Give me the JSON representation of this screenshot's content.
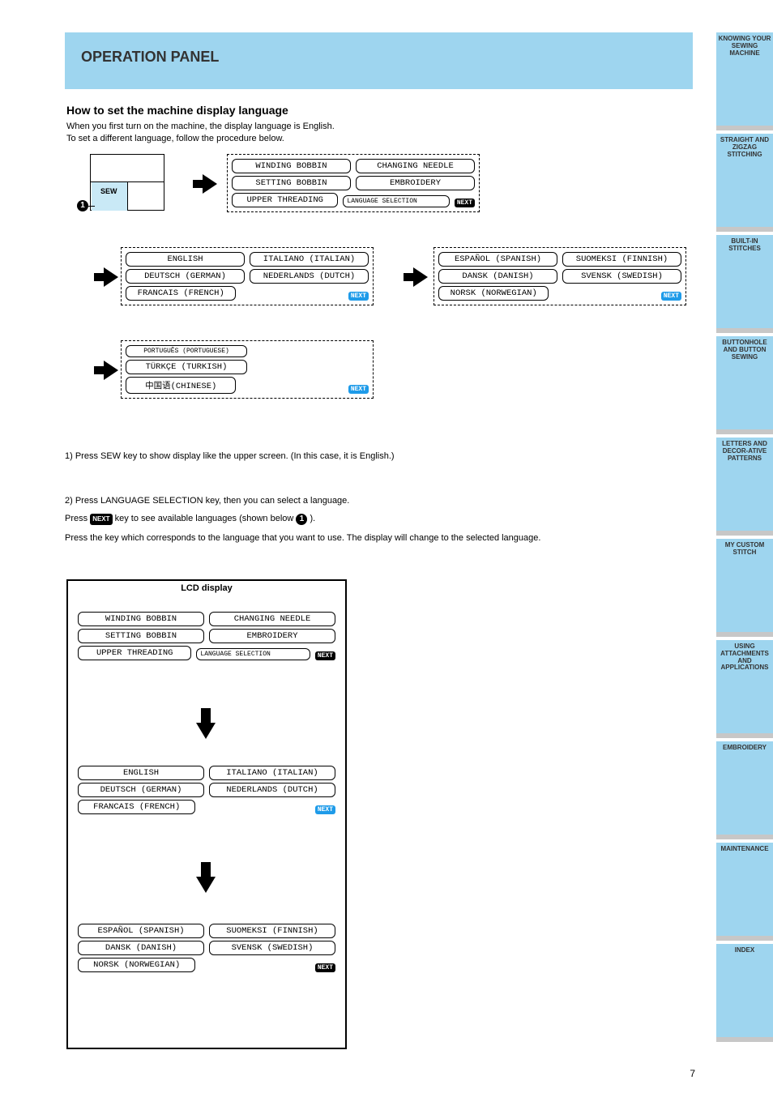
{
  "header": {
    "title": "OPERATION PANEL",
    "subtitle": "How to set the machine display language",
    "text1": "When you first turn on the machine, the display language is English.",
    "text2": "To set a different language, follow the procedure below."
  },
  "sew_btn": "SEW",
  "circle1": "1",
  "arrows": {
    "dummy": ""
  },
  "panelA": {
    "r1c1": "WINDING BOBBIN",
    "r1c2": "CHANGING NEEDLE",
    "r2c1": "SETTING BOBBIN",
    "r2c2": "EMBROIDERY",
    "r3c1": "UPPER THREADING",
    "r3c2": "LANGUAGE SELECTION",
    "next": "NEXT"
  },
  "panelB": {
    "r1c1": "ENGLISH",
    "r1c2": "ITALIANO (ITALIAN)",
    "r2c1": "DEUTSCH (GERMAN)",
    "r2c2": "NEDERLANDS (DUTCH)",
    "r3c1": "FRANCAIS (FRENCH)",
    "next": "NEXT"
  },
  "panelC": {
    "r1c1": "ESPAÑOL (SPANISH)",
    "r1c2": "SUOMEKSI (FINNISH)",
    "r2c1": "DANSK (DANISH)",
    "r2c2": "SVENSK (SWEDISH)",
    "r3c1": "NORSK (NORWEGIAN)",
    "next": "NEXT"
  },
  "panelD": {
    "r1c1": "PORTUGUÊS (PORTUGUESE)",
    "r2c1": "TÜRKÇE (TURKISH)",
    "r3c1": "中国语(CHINESE)",
    "next": "NEXT"
  },
  "para1": "1) Press   SEW   key to show display like the upper screen. (In this case, it is English.)",
  "para2a": "2) Press   LANGUAGE SELECTION   key, then you can select a language.",
  "para2b_prefix": "    Press ",
  "para2b_suffix": " key to see available languages (shown below ",
  "para2b_ref": "1",
  "para2b_end": ").",
  "para2c": "    Press the key which corresponds to the language that you want to use. The display will change to the selected language.",
  "lcd_title": "LCD display",
  "page": "7",
  "tabs": [
    "KNOWING YOUR SEWING MACHINE",
    "STRAIGHT AND ZIGZAG STITCHING",
    "BUILT-IN STITCHES",
    "BUTTONHOLE AND BUTTON SEWING",
    "LETTERS AND DECOR-ATIVE PATTERNS",
    "MY CUSTOM STITCH",
    "USING ATTACHMENTS AND APPLICATIONS",
    "EMBROIDERY",
    "MAINTENANCE",
    "INDEX"
  ],
  "next_tag": "NEXT"
}
